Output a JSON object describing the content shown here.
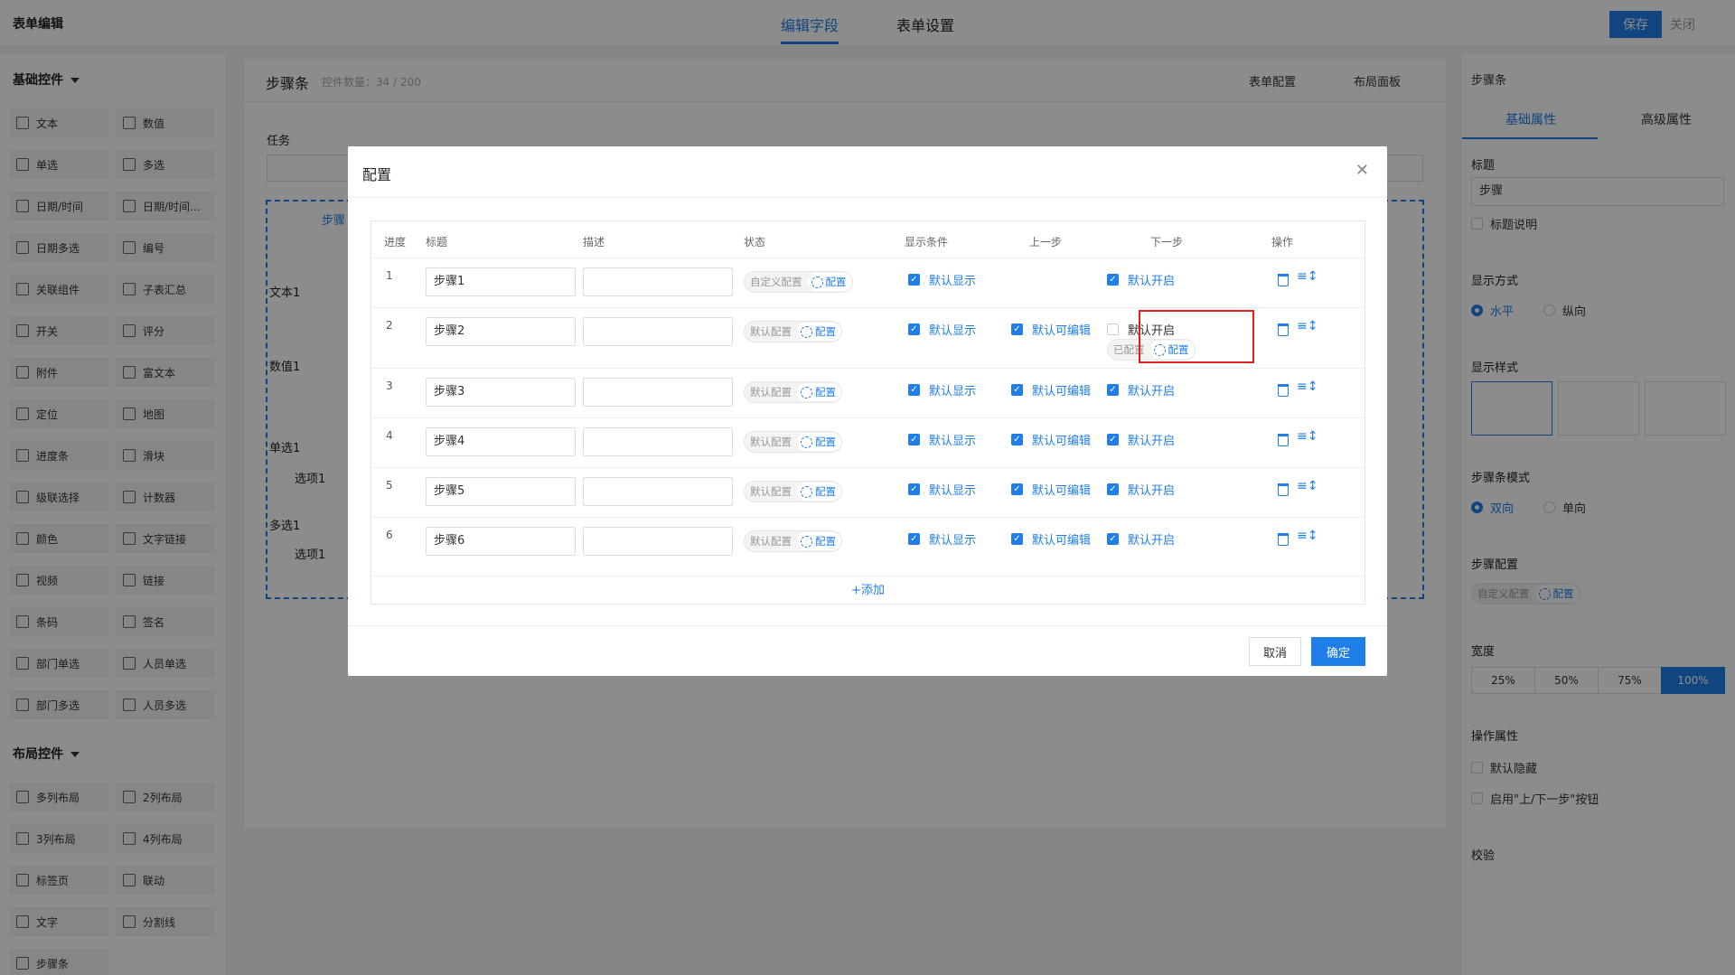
{
  "header": {
    "app_title": "表单编辑",
    "tabs": [
      "编辑字段",
      "表单设置"
    ],
    "save": "保存",
    "close": "关闭"
  },
  "left": {
    "basic_title": "基础控件",
    "basic": [
      [
        "文本",
        "数值"
      ],
      [
        "单选",
        "多选"
      ],
      [
        "日期/时间",
        "日期/时间..."
      ],
      [
        "日期多选",
        "编号"
      ],
      [
        "关联组件",
        "子表汇总"
      ],
      [
        "开关",
        "评分"
      ],
      [
        "附件",
        "富文本"
      ],
      [
        "定位",
        "地图"
      ],
      [
        "进度条",
        "滑块"
      ],
      [
        "级联选择",
        "计数器"
      ],
      [
        "颜色",
        "文字链接"
      ],
      [
        "视频",
        "链接"
      ],
      [
        "条码",
        "签名"
      ],
      [
        "部门单选",
        "人员单选"
      ],
      [
        "部门多选",
        "人员多选"
      ]
    ],
    "layout_title": "布局控件",
    "layout": [
      [
        "多列布局",
        "2列布局"
      ],
      [
        "3列布局",
        "4列布局"
      ],
      [
        "标签页",
        "联动"
      ],
      [
        "文字",
        "分割线"
      ],
      [
        "步骤条",
        ""
      ]
    ]
  },
  "canvas": {
    "title": "步骤条",
    "count": "控件数量：34 / 200",
    "form_config": "表单配置",
    "layout_panel": "布局面板",
    "task_label": "任务",
    "step_label": "步骤",
    "text1": "文本1",
    "num1": "数值1",
    "single1": "单选1",
    "option1": "选项1",
    "multi1": "多选1",
    "option1b": "选项1"
  },
  "right": {
    "head": "步骤条",
    "tabs": [
      "基础属性",
      "高级属性"
    ],
    "title_label": "标题",
    "title_value": "步骤",
    "title_desc": "标题说明",
    "display_mode": "显示方式",
    "horizontal": "水平",
    "vertical": "纵向",
    "display_style": "显示样式",
    "mode_label": "步骤条模式",
    "two_way": "双向",
    "one_way": "单向",
    "step_config": "步骤配置",
    "custom_config": "自定义配置",
    "config_btn": "配置",
    "width_label": "宽度",
    "widths": [
      "25%",
      "50%",
      "75%",
      "100%"
    ],
    "op_attr": "操作属性",
    "default_hidden": "默认隐藏",
    "enable_prevnext": "启用\"上/下一步\"按钮",
    "validate": "校验"
  },
  "modal": {
    "title": "配置",
    "headers": [
      "进度",
      "标题",
      "描述",
      "状态",
      "显示条件",
      "上一步",
      "下一步",
      "操作"
    ],
    "rows": [
      {
        "idx": "1",
        "title": "步骤1",
        "status": "自定义配置",
        "show": "默认显示",
        "prev": "",
        "next": "默认开启"
      },
      {
        "idx": "2",
        "title": "步骤2",
        "status": "默认配置",
        "show": "默认显示",
        "prev": "默认可编辑",
        "next": "默认开启",
        "next_status": "已配置"
      },
      {
        "idx": "3",
        "title": "步骤3",
        "status": "默认配置",
        "show": "默认显示",
        "prev": "默认可编辑",
        "next": "默认开启"
      },
      {
        "idx": "4",
        "title": "步骤4",
        "status": "默认配置",
        "show": "默认显示",
        "prev": "默认可编辑",
        "next": "默认开启"
      },
      {
        "idx": "5",
        "title": "步骤5",
        "status": "默认配置",
        "show": "默认显示",
        "prev": "默认可编辑",
        "next": "默认开启"
      },
      {
        "idx": "6",
        "title": "步骤6",
        "status": "默认配置",
        "show": "默认显示",
        "prev": "默认可编辑",
        "next": "默认开启"
      }
    ],
    "config_btn": "配置",
    "add": "+添加",
    "cancel": "取消",
    "ok": "确定"
  },
  "colors": {
    "accent": "#1f7ee8",
    "highlight": "#e02020"
  }
}
